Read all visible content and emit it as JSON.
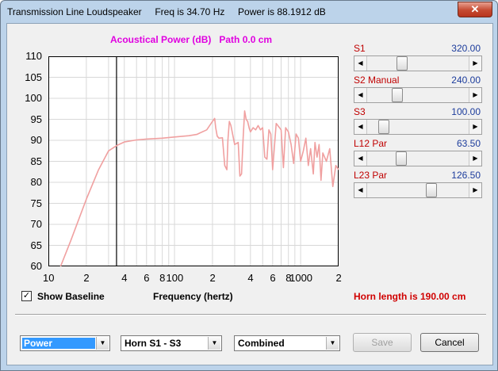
{
  "window": {
    "title": "Transmission Line Loudspeaker     Freq is 34.70 Hz     Power is 88.1912 dB",
    "close_glyph": "✕"
  },
  "chart_data": {
    "type": "line",
    "title": "Acoustical Power (dB)   Path 0.0 cm",
    "xlabel": "Frequency (hertz)",
    "ylabel": "",
    "x_scale": "log",
    "xlim": [
      10,
      2000
    ],
    "ylim": [
      60,
      110
    ],
    "y_ticks": [
      110,
      105,
      100,
      95,
      90,
      85,
      80,
      75,
      70,
      65,
      60
    ],
    "x_tick_labels": [
      "10",
      "2",
      "4",
      "6",
      "8",
      "100",
      "2",
      "4",
      "6",
      "8",
      "1000",
      "2"
    ],
    "x_tick_values": [
      10,
      20,
      40,
      60,
      80,
      100,
      200,
      400,
      600,
      800,
      1000,
      2000
    ],
    "grid": true,
    "marker_x": 34.7,
    "series": [
      {
        "color": "#f0a0a0",
        "x": [
          12.5,
          15,
          20,
          25,
          30,
          35,
          40,
          50,
          60,
          80,
          100,
          130,
          150,
          180,
          200,
          208,
          212,
          218,
          225,
          240,
          250,
          260,
          265,
          272,
          280,
          300,
          320,
          330,
          340,
          350,
          360,
          370,
          380,
          390,
          400,
          420,
          440,
          460,
          480,
          500,
          520,
          540,
          560,
          580,
          600,
          640,
          680,
          700,
          730,
          760,
          800,
          840,
          880,
          920,
          960,
          1000,
          1050,
          1100,
          1150,
          1200,
          1260,
          1300,
          1350,
          1400,
          1450,
          1500,
          1600,
          1700,
          1800,
          1900,
          2000
        ],
        "values": [
          60,
          66,
          76,
          83,
          87.5,
          88.8,
          89.6,
          90.1,
          90.3,
          90.5,
          90.8,
          91.1,
          91.4,
          92.5,
          94.5,
          95.2,
          93,
          91,
          90.5,
          90.6,
          84,
          83,
          90,
          94.5,
          93.5,
          89,
          89.5,
          81.5,
          82,
          90.5,
          97,
          95,
          94.5,
          93,
          92,
          93,
          92.5,
          93.5,
          92.5,
          93,
          86,
          85.5,
          92.5,
          91.5,
          83,
          94,
          93,
          92.5,
          83.5,
          93,
          92,
          89,
          84.5,
          91.5,
          90.5,
          85,
          87.5,
          90.5,
          84,
          88,
          82,
          89.5,
          86,
          89,
          80.5,
          87,
          85,
          88,
          79,
          84,
          83
        ]
      }
    ]
  },
  "sliders": [
    {
      "label": "S1",
      "value": "320.00",
      "fraction": 0.33
    },
    {
      "label": "S2  Manual",
      "value": "240.00",
      "fraction": 0.28
    },
    {
      "label": "S3",
      "value": "100.00",
      "fraction": 0.13
    },
    {
      "label": "L12  Par",
      "value": "63.50",
      "fraction": 0.32
    },
    {
      "label": "L23  Par",
      "value": "126.50",
      "fraction": 0.65
    }
  ],
  "controls": {
    "show_baseline_label": "Show Baseline",
    "show_baseline_checked": "✓",
    "horn_length": "Horn length is 190.00 cm",
    "separator": ""
  },
  "dropdowns": [
    {
      "value": "Power",
      "arrow": "▼",
      "highlighted": true
    },
    {
      "value": "Horn S1 - S3",
      "arrow": "▼",
      "highlighted": false
    },
    {
      "value": "Combined",
      "arrow": "▼",
      "highlighted": false
    }
  ],
  "buttons": {
    "save": "Save",
    "cancel": "Cancel"
  },
  "arrows": {
    "left": "◀",
    "right": "▶"
  },
  "colors": {
    "title_magenta": "#e000e0",
    "alert_red": "#d00000",
    "value_blue": "#1c3c9c",
    "selection_blue": "#3399ff"
  }
}
